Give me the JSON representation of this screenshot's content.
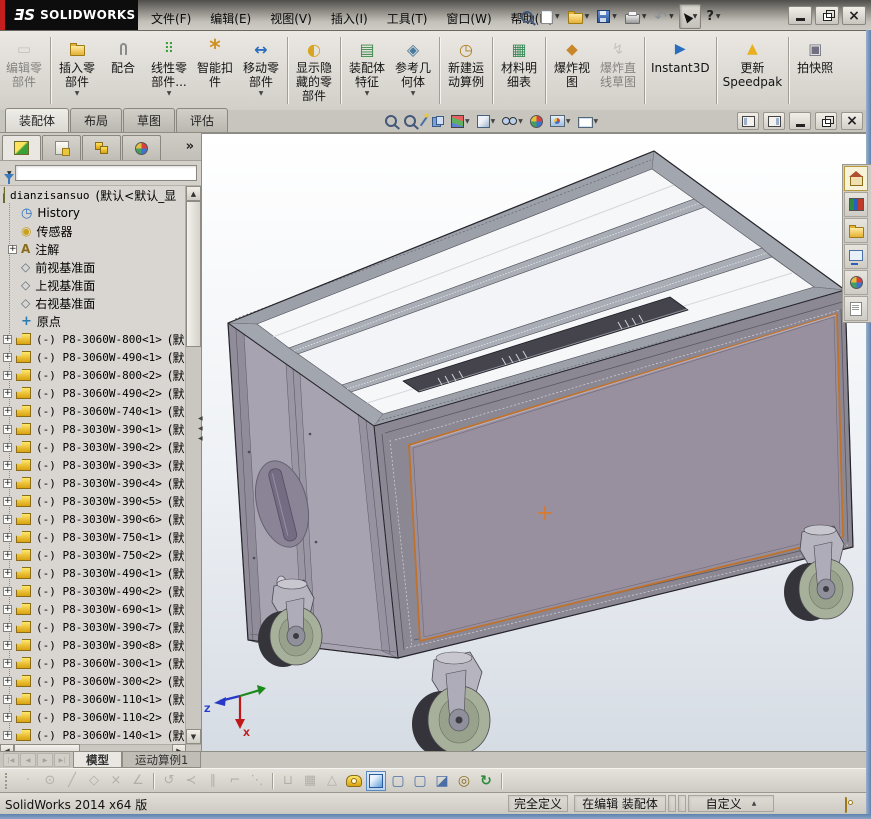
{
  "titlebar": {
    "logo_mark": "ƎS",
    "logo_text": "SOLIDWORKS",
    "menus": [
      {
        "label": "文件(F)"
      },
      {
        "label": "编辑(E)"
      },
      {
        "label": "视图(V)"
      },
      {
        "label": "插入(I)"
      },
      {
        "label": "工具(T)"
      },
      {
        "label": "窗口(W)"
      },
      {
        "label": "帮助(H)"
      }
    ],
    "quick_tools": [
      {
        "icon": "search"
      },
      {
        "icon": "new-file",
        "dropdown": true
      },
      {
        "icon": "open",
        "dropdown": true
      },
      {
        "icon": "save",
        "dropdown": true
      },
      {
        "icon": "print",
        "dropdown": true
      },
      {
        "icon": "undo",
        "dropdown": true
      },
      {
        "icon": "select-cursor",
        "dropdown": true,
        "pressed": true
      },
      {
        "icon": "help",
        "dropdown": true
      }
    ],
    "window_buttons": [
      {
        "icon": "minimize"
      },
      {
        "icon": "restore"
      },
      {
        "icon": "close"
      }
    ]
  },
  "command_manager": {
    "groups": [
      [
        {
          "icon": "edit-component",
          "lines": [
            "编辑零",
            "部件"
          ],
          "disabled": true
        }
      ],
      [
        {
          "icon": "insert-component",
          "lines": [
            "插入零",
            "部件"
          ],
          "dropdown": true
        },
        {
          "icon": "mate",
          "lines": [
            "配合"
          ]
        },
        {
          "icon": "linear-pattern",
          "lines": [
            "线性零",
            "部件..."
          ],
          "dropdown": true
        },
        {
          "icon": "smart-fasteners",
          "lines": [
            "智能扣",
            "件"
          ]
        },
        {
          "icon": "move-component",
          "lines": [
            "移动零",
            "部件"
          ],
          "dropdown": true
        }
      ],
      [
        {
          "icon": "show-hidden-components",
          "lines": [
            "显示隐",
            "藏的零",
            "部件"
          ]
        }
      ],
      [
        {
          "icon": "assembly-features",
          "lines": [
            "装配体",
            "特征"
          ],
          "dropdown": true
        },
        {
          "icon": "reference-geometry",
          "lines": [
            "参考几",
            "何体"
          ],
          "dropdown": true
        }
      ],
      [
        {
          "icon": "new-motion-study",
          "lines": [
            "新建运",
            "动算例"
          ]
        }
      ],
      [
        {
          "icon": "bom",
          "lines": [
            "材料明",
            "细表"
          ]
        }
      ],
      [
        {
          "icon": "exploded-view",
          "lines": [
            "爆炸视",
            "图"
          ]
        },
        {
          "icon": "explode-line-sketch",
          "lines": [
            "爆炸直",
            "线草图"
          ],
          "disabled": true
        }
      ],
      [
        {
          "icon": "instant3d",
          "lines": [
            "Instant3D"
          ]
        }
      ],
      [
        {
          "icon": "update-speedpak",
          "lines": [
            "更新",
            "Speedpak"
          ]
        }
      ],
      [
        {
          "icon": "take-snapshot",
          "lines": [
            "拍快照"
          ]
        }
      ]
    ],
    "tabs": {
      "items": [
        "装配体",
        "布局",
        "草图",
        "评估"
      ],
      "active_index": 0
    }
  },
  "headsup": {
    "tools": [
      {
        "icon": "zoom-fit"
      },
      {
        "icon": "zoom-area"
      },
      {
        "icon": "section-wand"
      },
      {
        "icon": "section-view"
      },
      {
        "icon": "view-orientation",
        "dropdown": true
      },
      {
        "icon": "display-style",
        "dropdown": true
      },
      {
        "icon": "hide-show-items",
        "dropdown": true
      },
      {
        "icon": "edit-appearance"
      },
      {
        "icon": "apply-scene",
        "dropdown": true
      },
      {
        "icon": "view-settings",
        "dropdown": true
      }
    ]
  },
  "doc_window_buttons": [
    {
      "icon": "pane-left"
    },
    {
      "icon": "pane-right"
    },
    {
      "icon": "minimize"
    },
    {
      "icon": "restore"
    },
    {
      "icon": "close"
    }
  ],
  "feature_panel": {
    "tabs": [
      {
        "icon": "feature-manager",
        "active": true
      },
      {
        "icon": "property-manager"
      },
      {
        "icon": "configuration-manager"
      },
      {
        "icon": "display-manager"
      }
    ],
    "overflow_glyph": "»",
    "expand_glyph": "+",
    "filter": {
      "icon": "filter-funnel",
      "value": ""
    },
    "root": {
      "label": "dianzisansuo",
      "config": "(默认<默认_显"
    },
    "items": [
      {
        "icon": "history",
        "label": "History"
      },
      {
        "icon": "sensors",
        "label": "传感器"
      },
      {
        "icon": "annotations",
        "label": "注解",
        "expandable": true
      },
      {
        "icon": "plane",
        "label": "前视基准面"
      },
      {
        "icon": "plane",
        "label": "上视基准面"
      },
      {
        "icon": "plane",
        "label": "右视基准面"
      },
      {
        "icon": "origin",
        "label": "原点"
      }
    ],
    "parts_suffix": "(默",
    "parts": [
      "(-) P8-3060W-800<1>",
      "(-) P8-3060W-490<1>",
      "(-) P8-3060W-800<2>",
      "(-) P8-3060W-490<2>",
      "(-) P8-3060W-740<1>",
      "(-) P8-3030W-390<1>",
      "(-) P8-3030W-390<2>",
      "(-) P8-3030W-390<3>",
      "(-) P8-3030W-390<4>",
      "(-) P8-3030W-390<5>",
      "(-) P8-3030W-390<6>",
      "(-) P8-3030W-750<1>",
      "(-) P8-3030W-750<2>",
      "(-) P8-3030W-490<1>",
      "(-) P8-3030W-490<2>",
      "(-) P8-3030W-690<1>",
      "(-) P8-3030W-390<7>",
      "(-) P8-3030W-390<8>",
      "(-) P8-3060W-300<1>",
      "(-) P8-3060W-300<2>",
      "(-) P8-3060W-110<1>",
      "(-) P8-3060W-110<2>",
      "(-) P8-3060W-140<1>"
    ]
  },
  "viewport": {
    "triad": {
      "x_label": "X",
      "z_label": "Z"
    },
    "origin_marker_color": "#e07820",
    "panel_color": "#98909f",
    "accent_color": "#c0722a"
  },
  "task_pane": [
    {
      "icon": "home",
      "active": true
    },
    {
      "icon": "design-library"
    },
    {
      "icon": "file-explorer"
    },
    {
      "icon": "view-palette"
    },
    {
      "icon": "appearances"
    },
    {
      "icon": "custom-properties"
    }
  ],
  "model_tabs": {
    "nav": [
      {
        "icon": "nav-first"
      },
      {
        "icon": "nav-prev"
      },
      {
        "icon": "nav-next"
      },
      {
        "icon": "nav-last"
      }
    ],
    "items": [
      {
        "label": "模型",
        "active": true
      },
      {
        "label": "运动算例1"
      }
    ]
  },
  "sketch_toolbar": [
    {
      "icon": "point",
      "disabled": true
    },
    {
      "icon": "circle",
      "disabled": true
    },
    {
      "icon": "line",
      "disabled": true
    },
    {
      "icon": "polygon",
      "disabled": true
    },
    {
      "icon": "trim",
      "disabled": true
    },
    {
      "icon": "angle",
      "disabled": true
    },
    {
      "sep": true
    },
    {
      "icon": "mirror",
      "disabled": true
    },
    {
      "icon": "converge",
      "disabled": true
    },
    {
      "icon": "offset",
      "disabled": true
    },
    {
      "icon": "corner",
      "disabled": true
    },
    {
      "icon": "construction",
      "disabled": true
    },
    {
      "sep": true
    },
    {
      "icon": "stretch",
      "disabled": true
    },
    {
      "icon": "grid",
      "disabled": true
    },
    {
      "icon": "triangle",
      "disabled": true
    },
    {
      "icon": "measure"
    },
    {
      "icon": "iso-cube",
      "active": true
    },
    {
      "icon": "cube-a"
    },
    {
      "icon": "cube-b"
    },
    {
      "icon": "section-cube"
    },
    {
      "icon": "rings"
    },
    {
      "icon": "refresh"
    },
    {
      "sep": true
    }
  ],
  "status_bar": {
    "left_text": "SolidWorks 2014 x64 版",
    "segments": [
      {
        "label": "完全定义"
      },
      {
        "label": "在编辑 装配体"
      },
      {
        "label": ""
      },
      {
        "label": ""
      },
      {
        "label": "自定义",
        "dropdown": true
      }
    ],
    "tag_icon": "tag"
  }
}
